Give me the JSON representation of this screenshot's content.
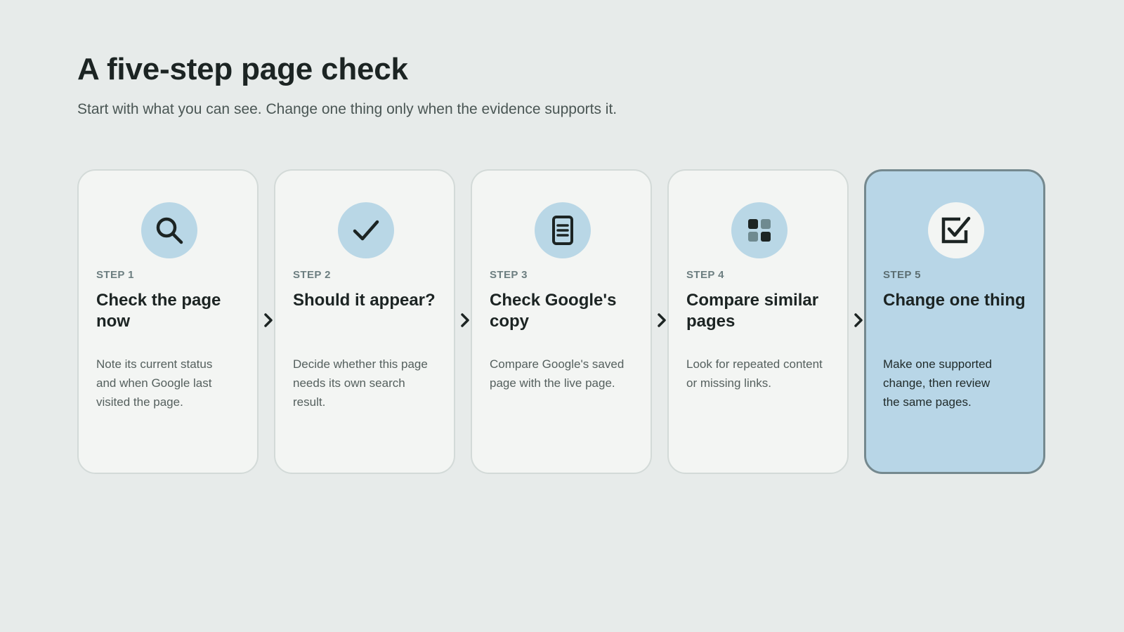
{
  "header": {
    "title": "A five-step page check",
    "subtitle": "Start with what you can see. Change one thing only when the evidence supports it."
  },
  "steps": [
    {
      "label": "STEP 1",
      "title": "Check the page now",
      "description": "Note its current status and when Google last visited the page.",
      "icon": "search-icon"
    },
    {
      "label": "STEP 2",
      "title": "Should it appear?",
      "description": "Decide whether this page needs its own search result.",
      "icon": "checkmark-icon"
    },
    {
      "label": "STEP 3",
      "title": "Check Google's copy",
      "description": "Compare Google's saved page with the live page.",
      "icon": "document-icon"
    },
    {
      "label": "STEP 4",
      "title": "Compare similar pages",
      "description": "Look for repeated content or missing links.",
      "icon": "grid-icon"
    },
    {
      "label": "STEP 5",
      "title": "Change one thing",
      "description": "Make one supported change, then review the same pages.",
      "icon": "checkbox-icon",
      "highlighted": true
    }
  ],
  "colors": {
    "background": "#e7ebea",
    "card": "#f3f5f3",
    "card_border": "#d3dad8",
    "highlight_card": "#b8d6e7",
    "highlight_border": "#75898f",
    "icon_circle": "#b9d7e6",
    "text_dark": "#1c2423",
    "step_label": "#6c7e80"
  }
}
